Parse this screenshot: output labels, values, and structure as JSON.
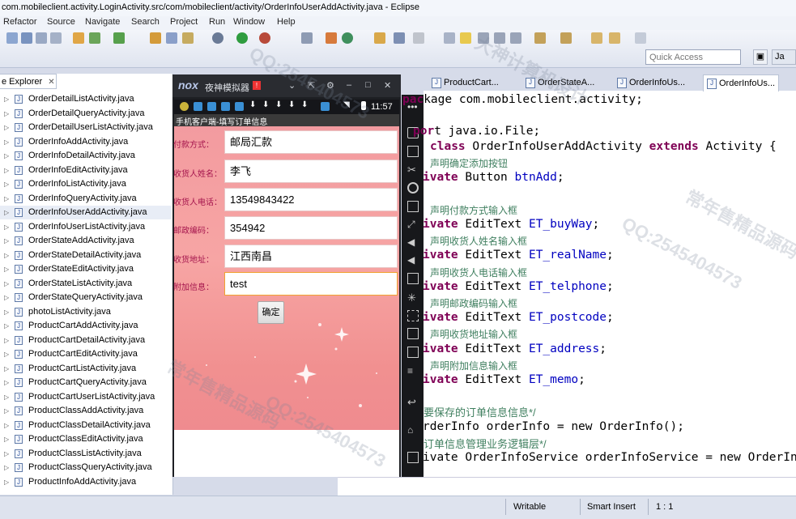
{
  "window": {
    "title": "com.mobileclient.activity.LoginActivity.src/com/mobileclient/activity/OrderInfoUserAddActivity.java - Eclipse"
  },
  "menu": [
    "Refactor",
    "Source",
    "Navigate",
    "Search",
    "Project",
    "Run",
    "Window",
    "Help"
  ],
  "toolbar": {
    "quick_access_placeholder": "Quick Access",
    "perspective_label": "Ja"
  },
  "package_explorer": {
    "tab_label": "e Explorer",
    "files": [
      "OrderDetailListActivity.java",
      "OrderDetailQueryActivity.java",
      "OrderDetailUserListActivity.java",
      "OrderInfoAddActivity.java",
      "OrderInfoDetailActivity.java",
      "OrderInfoEditActivity.java",
      "OrderInfoListActivity.java",
      "OrderInfoQueryActivity.java",
      "OrderInfoUserAddActivity.java",
      "OrderInfoUserListActivity.java",
      "OrderStateAddActivity.java",
      "OrderStateDetailActivity.java",
      "OrderStateEditActivity.java",
      "OrderStateListActivity.java",
      "OrderStateQueryActivity.java",
      "photoListActivity.java",
      "ProductCartAddActivity.java",
      "ProductCartDetailActivity.java",
      "ProductCartEditActivity.java",
      "ProductCartListActivity.java",
      "ProductCartQueryActivity.java",
      "ProductCartUserListActivity.java",
      "ProductClassAddActivity.java",
      "ProductClassDetailActivity.java",
      "ProductClassEditActivity.java",
      "ProductClassListActivity.java",
      "ProductClassQueryActivity.java",
      "ProductInfoAddActivity.java"
    ]
  },
  "emulator": {
    "logo": "nox",
    "title": "夜神模拟器",
    "clock": "11:57",
    "app_title": "手机客户端-填写订单信息",
    "fields": [
      {
        "label": "付款方式：",
        "value": "邮局汇款"
      },
      {
        "label": "收货人姓名：",
        "value": "李飞"
      },
      {
        "label": "收货人电话：",
        "value": "13549843422"
      },
      {
        "label": "邮政编码：",
        "value": "354942"
      },
      {
        "label": "收货地址：",
        "value": "江西南昌"
      },
      {
        "label": "附加信息：",
        "value": "test"
      }
    ],
    "confirm_label": "确定"
  },
  "editor": {
    "tabs": [
      "ProductCart...",
      "OrderStateA...",
      "OrderInfoUs...",
      "OrderInfoUs..."
    ],
    "code_package": "kage com.mobileclient.activity;",
    "code_import": "t java.io.File;",
    "code_class": "OrderInfoUserAddActivity",
    "code_extends": "Activity {",
    "comments": [
      "声明确定添加按钮",
      "声明付款方式输入框",
      "声明收货人姓名输入框",
      "声明收货人电话输入框",
      "声明邮政编码输入框",
      "声明收货地址输入框",
      "声明附加信息输入框",
      "要保存的订单信息信息*/",
      "订单信息管理业务逻辑层*/"
    ],
    "fields": [
      {
        "type": "Button",
        "name": "btnAdd"
      },
      {
        "type": "EditText",
        "name": "ET_buyWay"
      },
      {
        "type": "EditText",
        "name": "ET_realName"
      },
      {
        "type": "EditText",
        "name": "ET_telphone"
      },
      {
        "type": "EditText",
        "name": "ET_postcode"
      },
      {
        "type": "EditText",
        "name": "ET_address"
      },
      {
        "type": "EditText",
        "name": "ET_memo"
      }
    ],
    "line_orderinfo": "rderInfo orderInfo = new OrderInfo();",
    "line_service": "ivate OrderInfoService orderInfoService = new OrderIn"
  },
  "status": {
    "writable": "Writable",
    "insert_mode": "Smart Insert",
    "position": "1 : 1"
  },
  "watermarks": [
    "QQ:2545404573",
    "常年售精品源码",
    "大神计算机设计"
  ]
}
